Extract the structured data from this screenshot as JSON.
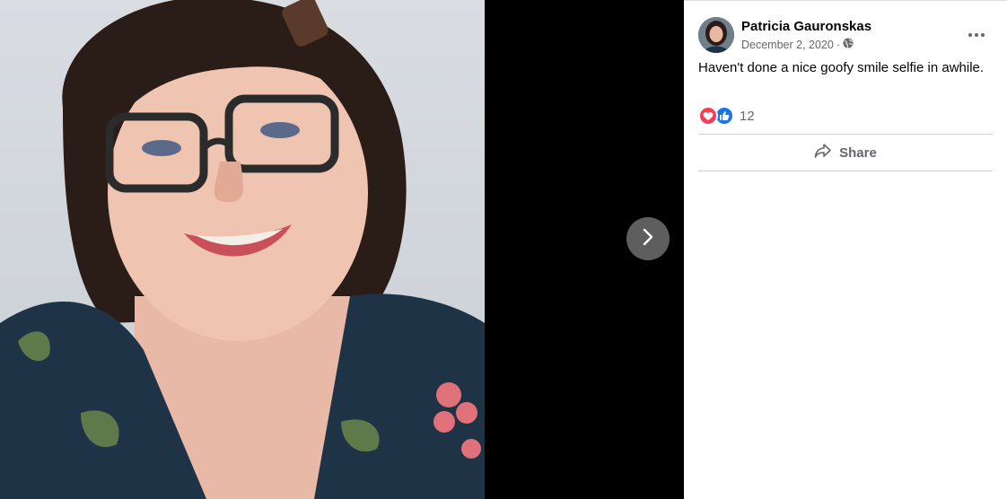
{
  "post": {
    "author": "Patricia Gauronskas",
    "date": "December 2, 2020",
    "separator": "·",
    "audience_icon": "globe-icon",
    "caption": "Haven't done a nice goofy smile selfie in awhile.",
    "reaction_count": "12",
    "reaction_icons": [
      "love-icon",
      "like-icon"
    ],
    "share_label": "Share"
  },
  "viewer": {
    "next_icon": "chevron-right-icon"
  },
  "colors": {
    "love": "#f33e58",
    "like": "#1b74e4",
    "secondary_text": "#65676b",
    "divider": "#ced0d4"
  }
}
